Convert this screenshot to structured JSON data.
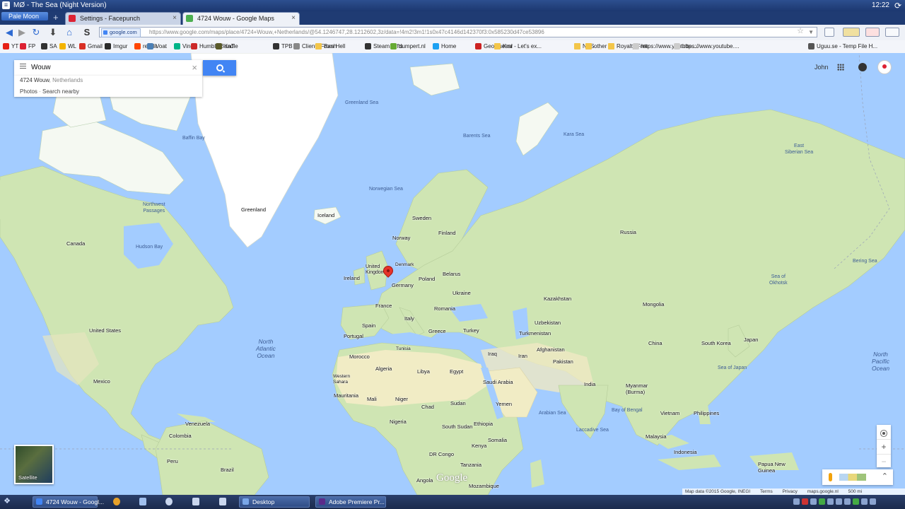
{
  "window": {
    "title": "MØ - The Sea (Night Version)",
    "clock": "12:22"
  },
  "browser": {
    "app_button": "Pale Moon",
    "tabs": [
      {
        "label": "Settings - Facepunch",
        "active": false
      },
      {
        "label": "4724 Wouw - Google Maps",
        "active": true
      }
    ],
    "identity": "google.com",
    "url_domain": "https://www.google.com",
    "url_path": "/maps/place/4724+Wouw,+Netherlands/@54.1246747,28.1212602,3z/data=!4m2!3m1!1s0x47c4146d142370f3:0x585230d47ce53896"
  },
  "bookmarks": [
    {
      "label": "YT",
      "color": "#e62117"
    },
    {
      "label": "FP",
      "color": "#d23"
    },
    {
      "label": "SA",
      "color": "#333"
    },
    {
      "label": "WL",
      "color": "#f4b400"
    },
    {
      "label": "Gmail",
      "color": "#d93025"
    },
    {
      "label": "Imgur",
      "color": "#2b2b2b"
    },
    {
      "label": "reddit",
      "color": "#ff4500"
    },
    {
      "label": "Voat",
      "color": "#4b7fb5"
    },
    {
      "label": "Vine",
      "color": "#00b488"
    },
    {
      "label": "Humble Bundle",
      "color": "#cc2929"
    },
    {
      "label": "KaT",
      "color": "#5a5a2a"
    },
    {
      "label": "TPB",
      "color": "#333"
    },
    {
      "label": "Clients From Hell",
      "color": "#888"
    },
    {
      "label": "Bash",
      "color": "#f3c64a"
    },
    {
      "label": "Steam Gifts",
      "color": "#333"
    },
    {
      "label": "dumpert.nl",
      "color": "#66aa33"
    },
    {
      "label": "Home",
      "color": "#1da1f2"
    },
    {
      "label": "GeoGuessr - Let's ex...",
      "color": "#c22"
    },
    {
      "label": "Kml",
      "color": "#f3c64a"
    },
    {
      "label": "NAS",
      "color": "#f3c64a"
    },
    {
      "label": "other",
      "color": "#f3c64a"
    },
    {
      "label": "Royalty Free",
      "color": "#f3c64a"
    },
    {
      "label": "https://www.youtube....",
      "color": "#ccc"
    },
    {
      "label": "https://www.youtube....",
      "color": "#ccc"
    },
    {
      "label": "Uguu.se - Temp File H...",
      "color": "#555"
    }
  ],
  "search": {
    "value": "Wouw",
    "clear_icon": "×"
  },
  "suggestion": {
    "place": "4724 Wouw",
    "country": ", Netherlands",
    "photos": "Photos",
    "separator": " · ",
    "nearby": "Search nearby"
  },
  "account": {
    "name": "John"
  },
  "map_labels": {
    "greenland_sea": "Greenland Sea",
    "baffin_bay": "Baffin Bay",
    "barents_sea": "Barents Sea",
    "kara_sea": "Kara Sea",
    "east_siberian_sea": "East\nSiberian Sea",
    "norwegian_sea": "Norwegian Sea",
    "northwest_passages": "Northwest\nPassages",
    "greenland": "Greenland",
    "iceland": "Iceland",
    "sweden": "Sweden",
    "norway": "Norway",
    "finland": "Finland",
    "russia": "Russia",
    "canada": "Canada",
    "hudson_bay": "Hudson Bay",
    "denmark": "Denmark",
    "united_kingdom": "United\nKingdom",
    "belarus": "Belarus",
    "ireland": "Ireland",
    "germany": "Germany",
    "poland": "Poland",
    "ukraine": "Ukraine",
    "kazakhstan": "Kazakhstan",
    "mongolia": "Mongolia",
    "france": "France",
    "romania": "Romania",
    "sea_of_okhotsk": "Sea of\nOkhotsk",
    "bering_sea": "Bering Sea",
    "united_states": "United States",
    "italy": "Italy",
    "spain": "Spain",
    "uzbekistan": "Uzbekistan",
    "turkmenistan": "Turkmenistan",
    "greece": "Greece",
    "turkey": "Turkey",
    "china": "China",
    "south_korea": "South Korea",
    "japan": "Japan",
    "north_atlantic_ocean": "North\nAtlantic\nOcean",
    "portugal": "Portugal",
    "afghanistan": "Afghanistan",
    "iraq": "Iraq",
    "iran": "Iran",
    "sea_of_japan": "Sea of Japan",
    "morocco": "Morocco",
    "tunisia": "Tunisia",
    "pakistan": "Pakistan",
    "algeria": "Algeria",
    "libya": "Libya",
    "egypt": "Egypt",
    "north_pacific_ocean": "North\nPacific\nOcean",
    "mexico": "Mexico",
    "western_sahara": "Western\nSahara",
    "saudi_arabia": "Saudi Arabia",
    "india": "India",
    "myanmar": "Myanmar\n(Burma)",
    "mauritania": "Mauritania",
    "mali": "Mali",
    "niger": "Niger",
    "chad": "Chad",
    "sudan": "Sudan",
    "yemen": "Yemen",
    "bay_of_bengal": "Bay of Bengal",
    "philippines": "Philippines",
    "vietnam": "Vietnam",
    "arabian_sea": "Arabian Sea",
    "nigeria": "Nigeria",
    "south_sudan": "South Sudan",
    "ethiopia": "Ethiopia",
    "venezuela": "Venezuela",
    "somalia": "Somalia",
    "laccadive_sea": "Laccadive Sea",
    "malaysia": "Malaysia",
    "colombia": "Colombia",
    "kenya": "Kenya",
    "indonesia": "Indonesia",
    "dr_congo": "DR Congo",
    "tanzania": "Tanzania",
    "peru": "Peru",
    "brazil": "Brazil",
    "papua_new_guinea": "Papua New\nGuinea",
    "angola": "Angola",
    "mozambique": "Mozambique"
  },
  "map_controls": {
    "satellite": "Satellite",
    "zoom_in": "+",
    "zoom_out": "−",
    "pegman_up": "⌃",
    "logo": "Google"
  },
  "map_footer": {
    "data": "Map data ©2015 Google, INEGI",
    "terms": "Terms",
    "privacy": "Privacy",
    "domain": "maps.google.nl",
    "scale": "500 mi"
  },
  "taskbar": {
    "tasks": [
      {
        "label": "4724 Wouw - Googl...",
        "color": "#4285f4"
      },
      {
        "label": "Desktop",
        "color": "#7aa7e8"
      },
      {
        "label": "Adobe Premiere Pr...",
        "color": "#5b2b8a"
      }
    ]
  },
  "colors": {
    "ocean": "#a3ccff",
    "land": "#cfe5b3",
    "desert": "#f1ecc5",
    "ice": "#ffffff",
    "pin": "#e5332a",
    "search_button": "#4285f4"
  }
}
